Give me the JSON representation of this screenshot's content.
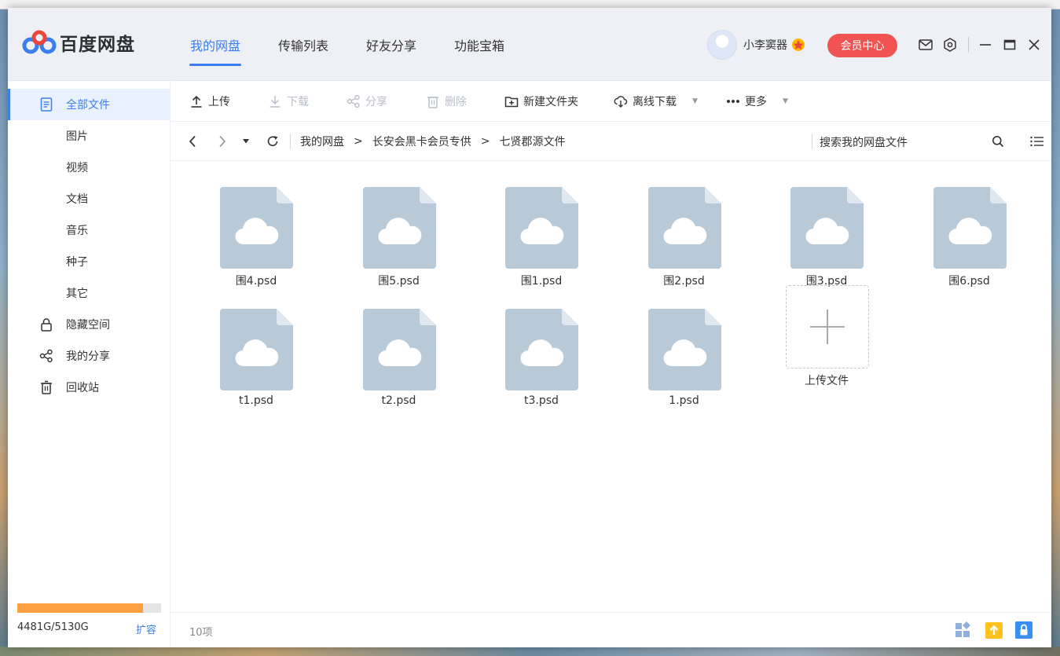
{
  "app": {
    "name": "百度网盘"
  },
  "nav": [
    {
      "label": "我的网盘",
      "active": true
    },
    {
      "label": "传输列表",
      "active": false
    },
    {
      "label": "好友分享",
      "active": false
    },
    {
      "label": "功能宝箱",
      "active": false
    }
  ],
  "user": {
    "name": "小李窦器",
    "vip_label": "会员中心"
  },
  "sidebar": {
    "items": [
      {
        "label": "全部文件",
        "icon": "document-icon",
        "active": true
      },
      {
        "label": "图片"
      },
      {
        "label": "视频"
      },
      {
        "label": "文档"
      },
      {
        "label": "音乐"
      },
      {
        "label": "种子"
      },
      {
        "label": "其它"
      },
      {
        "label": "隐藏空间",
        "icon": "lock-icon"
      },
      {
        "label": "我的分享",
        "icon": "share-icon"
      },
      {
        "label": "回收站",
        "icon": "trash-icon"
      }
    ],
    "storage": {
      "used_fraction": 0.8739,
      "text": "4481G/5130G",
      "expand_label": "扩容"
    }
  },
  "toolbar": {
    "upload": "上传",
    "download": "下载",
    "share": "分享",
    "delete": "删除",
    "new_folder": "新建文件夹",
    "offline_download": "离线下载",
    "more": "更多"
  },
  "breadcrumb": [
    "我的网盘",
    "长安会黑卡会员专供",
    "七贤郡源文件"
  ],
  "breadcrumb_sep": ">",
  "search": {
    "placeholder": "搜索我的网盘文件"
  },
  "files": [
    {
      "name": "围4.psd"
    },
    {
      "name": "围5.psd"
    },
    {
      "name": "围1.psd"
    },
    {
      "name": "围2.psd"
    },
    {
      "name": "围3.psd"
    },
    {
      "name": "围6.psd"
    },
    {
      "name": "t1.psd"
    },
    {
      "name": "t2.psd"
    },
    {
      "name": "t3.psd"
    },
    {
      "name": "1.psd"
    }
  ],
  "upload_tile": {
    "label": "上传文件"
  },
  "status": {
    "count": "10项"
  },
  "colors": {
    "accent": "#3a7ef0",
    "vip_button": "#f05352",
    "storage_fill": "#fca041",
    "file_icon": "#b8c9d8"
  }
}
